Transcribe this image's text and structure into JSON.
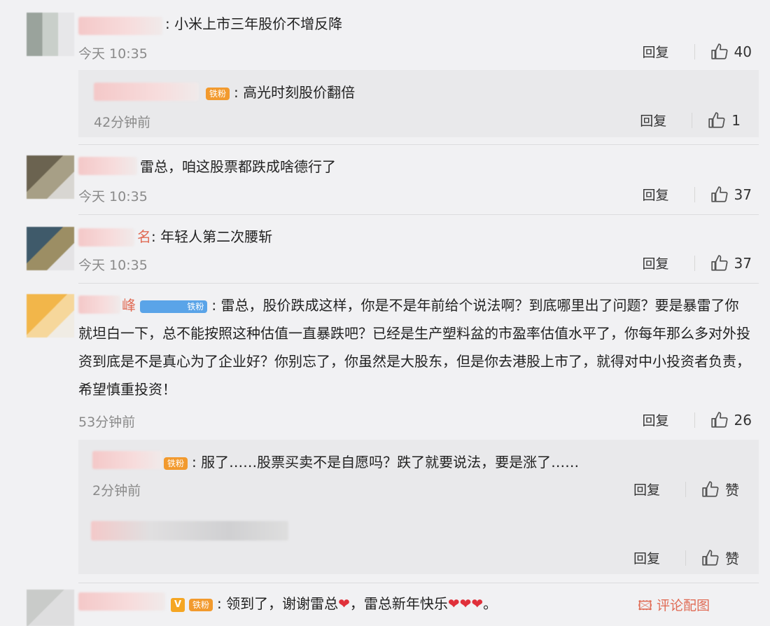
{
  "comments": [
    {
      "text": ": 小米上市三年股价不增反降",
      "time": "今天 10:35",
      "reply": "回复",
      "likes": "40",
      "sub": [
        {
          "badge": "铁粉",
          "text": ": 高光时刻股价翻倍",
          "time": "42分钟前",
          "reply": "回复",
          "likes": "1"
        }
      ]
    },
    {
      "text": "雷总，咱这股票都跌成啥德行了",
      "time": "今天 10:35",
      "reply": "回复",
      "likes": "37"
    },
    {
      "name_tail": "名",
      "text": ": 年轻人第二次腰斩",
      "time": "今天 10:35",
      "reply": "回复",
      "likes": "37"
    },
    {
      "name_tail": "峰",
      "badge": "铁粉",
      "text": ": 雷总，股价跌成这样，你是不是年前给个说法啊？到底哪里出了问题？要是暴雷了你就坦白一下，总不能按照这种估值一直暴跌吧？已经是生产塑料盆的市盈率估值水平了，你每年那么多对外投资到底是不是真心为了企业好？你别忘了，你虽然是大股东，但是你去港股上市了，就得对中小投资者负责，希望慎重投资！",
      "time": "53分钟前",
      "reply": "回复",
      "likes": "26",
      "sub": [
        {
          "badge": "铁粉",
          "text": ": 服了……股票买卖不是自愿吗？跌了就要说法，要是涨了……",
          "time": "2分钟前",
          "reply": "回复",
          "likes": "赞"
        },
        {
          "reply": "回复",
          "likes": "赞"
        }
      ]
    },
    {
      "v_badge": "V",
      "badge": "铁粉",
      "text": ": 领到了，谢谢雷总",
      "text2": "，雷总新年快乐",
      "hearts_end": "。",
      "link": "评论配图"
    }
  ],
  "icons": {
    "like": "thumbs-up-icon",
    "heart": "heart-icon",
    "image": "image-icon"
  },
  "colors": {
    "heart": "#e0303a",
    "badge": "#f29a2e",
    "link": "#e06b55"
  }
}
